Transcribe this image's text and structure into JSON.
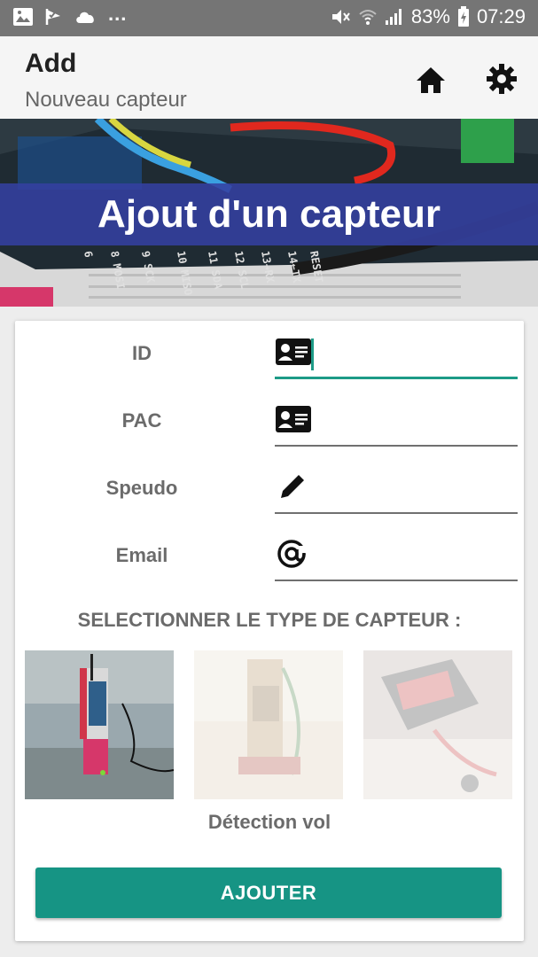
{
  "status_bar": {
    "overflow": "...",
    "battery_percent": "83%",
    "time": "07:29",
    "icons": [
      "image-icon",
      "check-flag-icon",
      "cloud-icon",
      "mute-icon",
      "wifi-icon",
      "signal-icon",
      "battery-icon"
    ]
  },
  "toolbar": {
    "title": "Add",
    "subtitle": "Nouveau capteur",
    "icons": [
      "home-icon",
      "gear-icon"
    ]
  },
  "banner": {
    "caption": "Ajout d'un capteur"
  },
  "form": {
    "fields": [
      {
        "label": "ID",
        "icon": "id-card-icon",
        "value": "",
        "focused": true
      },
      {
        "label": "PAC",
        "icon": "id-card-icon",
        "value": "",
        "focused": false
      },
      {
        "label": "Speudo",
        "icon": "pencil-icon",
        "value": "",
        "focused": false
      },
      {
        "label": "Email",
        "icon": "at-sign-icon",
        "value": "",
        "focused": false
      }
    ]
  },
  "sensor_types": {
    "title": "SELECTIONNER LE TYPE DE CAPTEUR :",
    "selected_caption": "Détection vol",
    "selected_index": 0
  },
  "actions": {
    "add_label": "AJOUTER"
  },
  "colors": {
    "accent": "#169484",
    "focus_underline": "#1d9b87",
    "banner_caption_bg": "#3440a0",
    "status_bar": "#757575"
  }
}
